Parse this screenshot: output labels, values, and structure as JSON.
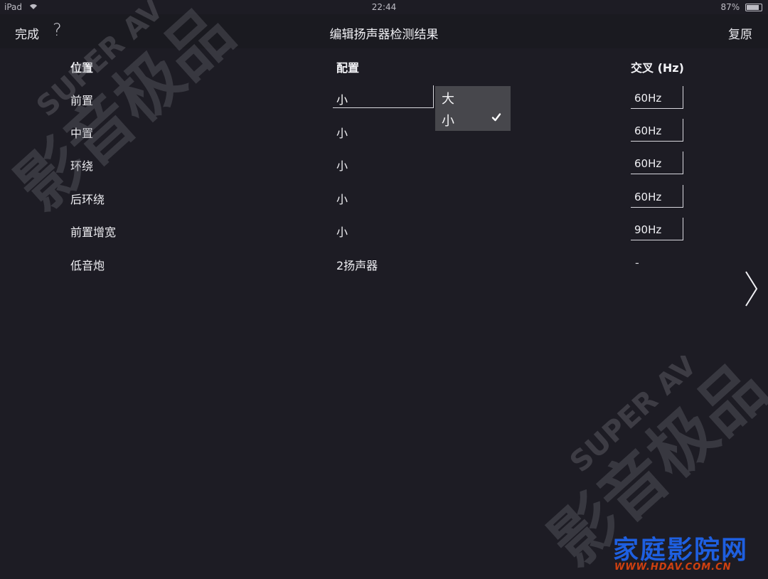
{
  "status_bar": {
    "device": "iPad",
    "time": "22:44",
    "battery_text": "87%",
    "battery_level": 0.87
  },
  "nav": {
    "done_label": "完成",
    "help_label": "?",
    "title": "编辑扬声器检测结果",
    "reset_label": "复原"
  },
  "table": {
    "headers": {
      "position": "位置",
      "config": "配置",
      "crossover": "交叉 (Hz)"
    },
    "rows": [
      {
        "position": "前置",
        "config": "小",
        "crossover": "60Hz"
      },
      {
        "position": "中置",
        "config": "小",
        "crossover": "60Hz"
      },
      {
        "position": "环绕",
        "config": "小",
        "crossover": "60Hz"
      },
      {
        "position": "后环绕",
        "config": "小",
        "crossover": "60Hz"
      },
      {
        "position": "前置增宽",
        "config": "小",
        "crossover": "90Hz"
      },
      {
        "position": "低音炮",
        "config": "2扬声器",
        "crossover": "-"
      }
    ]
  },
  "dropdown": {
    "options": [
      {
        "label": "大",
        "selected": false
      },
      {
        "label": "小",
        "selected": true
      }
    ]
  },
  "watermark": {
    "text": "影音极品",
    "subtext": "SUPER AV"
  },
  "brand": {
    "name": "家庭影院网",
    "url": "WWW.HDAV.COM.CN"
  },
  "colors": {
    "background": "#1d1c24",
    "dropdown_bg": "#47474c",
    "brand_blue": "#1e5fe0",
    "brand_orange": "#d04010"
  }
}
